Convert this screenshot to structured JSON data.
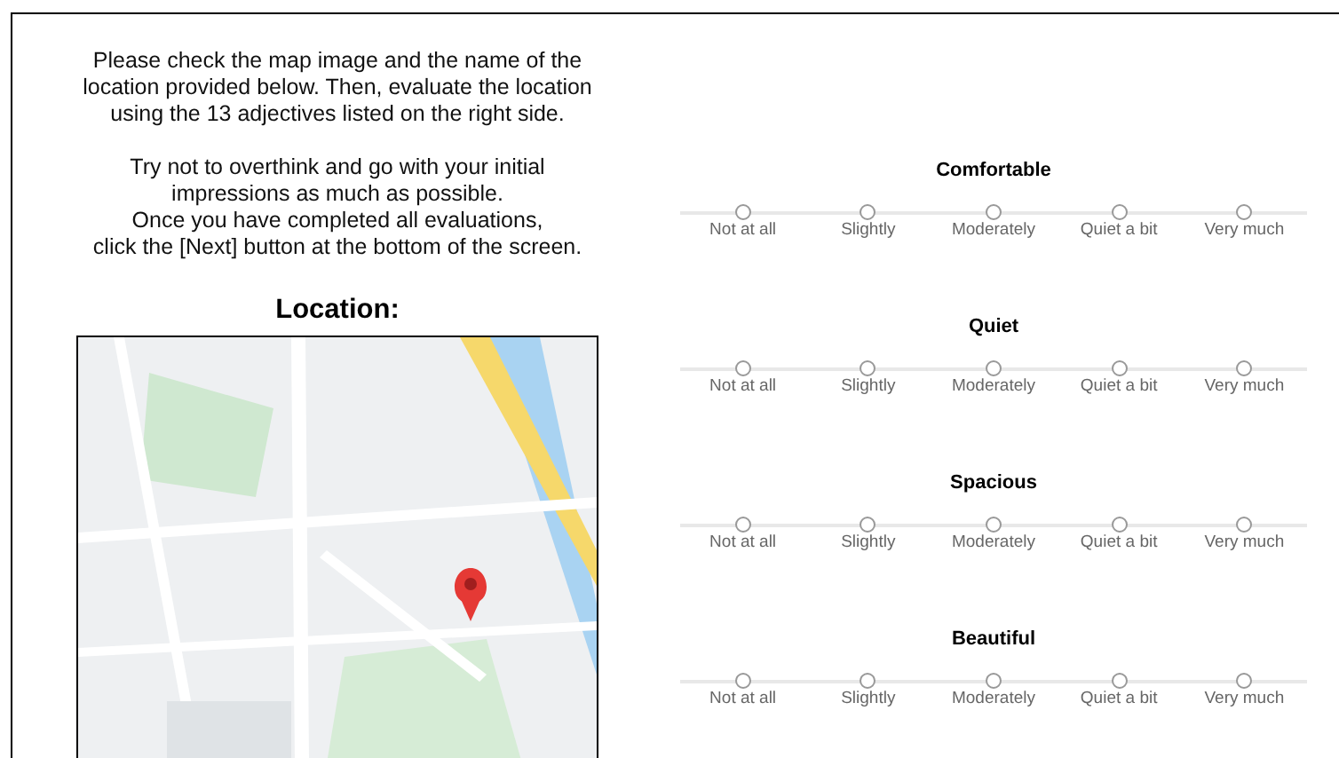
{
  "instructions": [
    "Please check the map image and the name of the location provided below. Then, evaluate the location using the 13 adjectives listed on the right side.",
    "Try not to overthink and go with your initial impressions as much as possible.",
    "Once you have completed all evaluations,",
    "click the [Next] button at the bottom of the screen."
  ],
  "location": {
    "heading": "Location:"
  },
  "scales": [
    {
      "adjective": "Comfortable",
      "options": [
        {
          "label": "Not at all",
          "selected": false
        },
        {
          "label": "Slightly",
          "selected": false
        },
        {
          "label": "Moderately",
          "selected": false
        },
        {
          "label": "Quiet a bit",
          "selected": false
        },
        {
          "label": "Very much",
          "selected": false
        }
      ]
    },
    {
      "adjective": "Quiet",
      "options": [
        {
          "label": "Not at all",
          "selected": false
        },
        {
          "label": "Slightly",
          "selected": false
        },
        {
          "label": "Moderately",
          "selected": false
        },
        {
          "label": "Quiet a bit",
          "selected": false
        },
        {
          "label": "Very much",
          "selected": false
        }
      ]
    },
    {
      "adjective": "Spacious",
      "options": [
        {
          "label": "Not at all",
          "selected": false
        },
        {
          "label": "Slightly",
          "selected": false
        },
        {
          "label": "Moderately",
          "selected": false
        },
        {
          "label": "Quiet a bit",
          "selected": false
        },
        {
          "label": "Very much",
          "selected": false
        }
      ]
    },
    {
      "adjective": "Beautiful",
      "options": [
        {
          "label": "Not at all",
          "selected": false
        },
        {
          "label": "Slightly",
          "selected": false
        },
        {
          "label": "Moderately",
          "selected": false
        },
        {
          "label": "Quiet a bit",
          "selected": false
        },
        {
          "label": "Very much",
          "selected": false
        }
      ]
    }
  ]
}
